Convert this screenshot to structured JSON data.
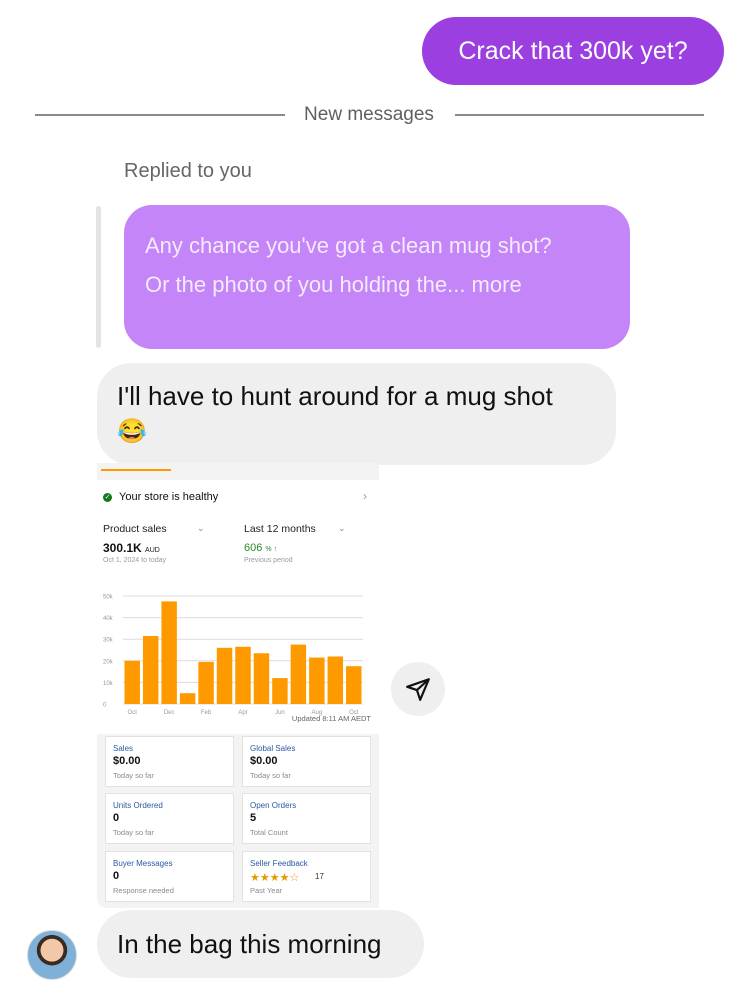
{
  "messages": {
    "outgoing": "Crack that 300k yet?",
    "divider": "New messages",
    "replied_label": "Replied to you",
    "reply_quote_line1": "Any chance you've got a clean mug shot?",
    "reply_quote_line2": "Or the photo of you holding the... more",
    "incoming_1": "I'll have to hunt around for a mug shot",
    "incoming_1_emoji": "😂",
    "incoming_2": "In the bag this morning"
  },
  "store": {
    "health_text": "Your store is healthy",
    "metric_dropdown": "Product sales",
    "period_dropdown": "Last 12 months",
    "sales_value": "300.1K",
    "sales_currency": "AUD",
    "sales_range": "Oct 1, 2024 to today",
    "growth_value": "606",
    "growth_unit": "% ↑",
    "growth_label": "Previous period",
    "updated": "Updated 8:11 AM AEDT"
  },
  "cards": [
    {
      "title": "Sales",
      "value": "$0.00",
      "sub": "Today so far"
    },
    {
      "title": "Global Sales",
      "value": "$0.00",
      "sub": "Today so far"
    },
    {
      "title": "Units Ordered",
      "value": "0",
      "sub": "Today so far"
    },
    {
      "title": "Open Orders",
      "value": "5",
      "sub": "Total Count"
    },
    {
      "title": "Buyer Messages",
      "value": "0",
      "sub": "Response needed"
    },
    {
      "title": "Seller Feedback",
      "value": "17",
      "sub": "Past Year",
      "rating": 4.5
    }
  ],
  "chart_data": {
    "type": "bar",
    "categories": [
      "Oct",
      "Nov",
      "Dec",
      "Jan",
      "Feb",
      "Mar",
      "Apr",
      "May",
      "Jun",
      "Jul",
      "Aug",
      "Sep",
      "Oct"
    ],
    "tick_labels": [
      "Oct",
      "Dec",
      "Feb",
      "Apr",
      "Jun",
      "Aug",
      "Oct"
    ],
    "values": [
      20000,
      31500,
      47500,
      5000,
      19500,
      26000,
      26500,
      23500,
      12000,
      27500,
      21500,
      22000,
      17500
    ],
    "y_ticks": [
      "0",
      "10k",
      "20k",
      "30k",
      "40k",
      "50k"
    ],
    "ylim": [
      0,
      50000
    ],
    "color": "#ff9900",
    "grid": true
  },
  "colors": {
    "outgoing_bubble": "#9b3fe0",
    "reply_bubble": "#c385f7",
    "incoming_bubble": "#efefef",
    "bar": "#ff9900"
  }
}
